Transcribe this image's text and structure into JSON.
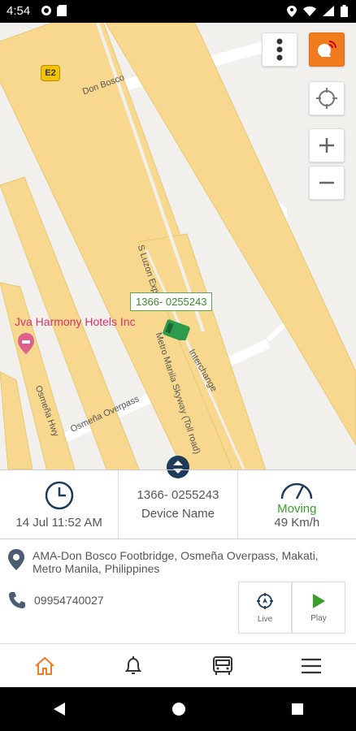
{
  "status_bar": {
    "time": "4:54"
  },
  "map": {
    "road_labels": [
      "Don Bosco",
      "S Luzon Expwy",
      "Metro Manila Skyway (Toll road)",
      "Interchange",
      "Osmeña Hwy",
      "Osmeña Overpass"
    ],
    "highway_shield": "E2",
    "poi": "Jva Harmony Hotels Inc",
    "vehicle_label": "1366- 0255243"
  },
  "info": {
    "datetime": "14 Jul 11:52 AM",
    "device_id": "1366- 0255243",
    "device_name_label": "Device Name",
    "status": "Moving",
    "speed": "49 Km/h"
  },
  "address": "AMA-Don Bosco Footbridge, Osmeña Overpass, Makati, Metro Manila, Philippines",
  "phone": "09954740027",
  "actions": {
    "live": "Live",
    "play": "Play"
  },
  "colors": {
    "accent": "#f07c1e",
    "moving": "#3aa02c",
    "road": "#f7d88e",
    "handle": "#1f3b5a"
  }
}
